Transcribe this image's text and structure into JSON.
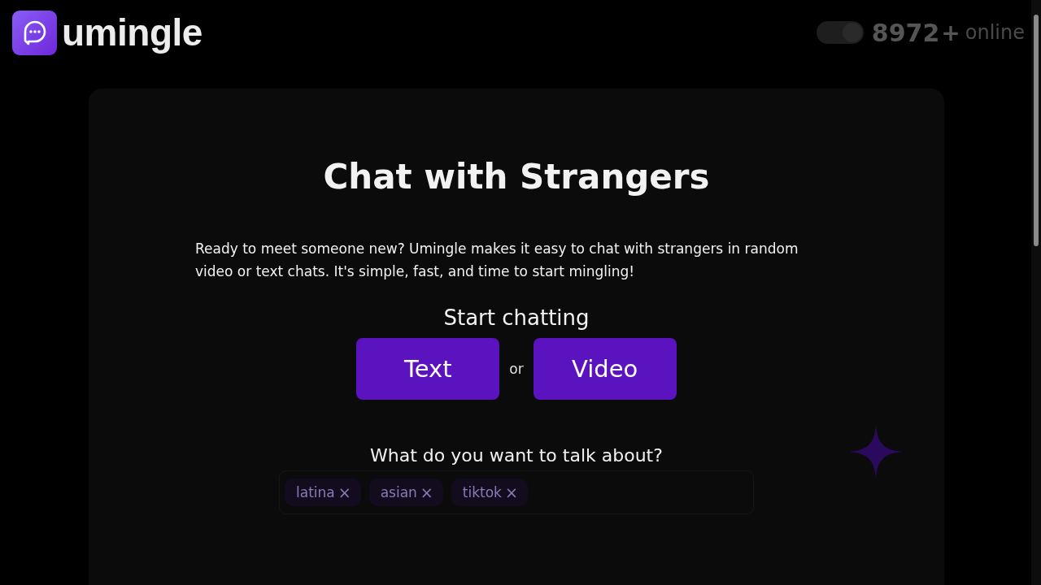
{
  "header": {
    "logo_text": "umingle",
    "theme_toggle": {
      "on": true
    },
    "online_count": "8972",
    "online_plus": "+",
    "online_label": "online"
  },
  "hero": {
    "title": "Chat with Strangers",
    "description": "Ready to meet someone new? Umingle makes it easy to chat with strangers in random video or text chats. It's simple, fast, and time to start mingling!",
    "start_label": "Start chatting",
    "buttons": [
      "Text",
      "Video"
    ],
    "separator": "or",
    "interests_label": "What do you want to talk about?",
    "interests": [
      {
        "label": "latina",
        "remove": "×"
      },
      {
        "label": "asian",
        "remove": "×"
      },
      {
        "label": "tiktok",
        "remove": "×"
      }
    ]
  }
}
